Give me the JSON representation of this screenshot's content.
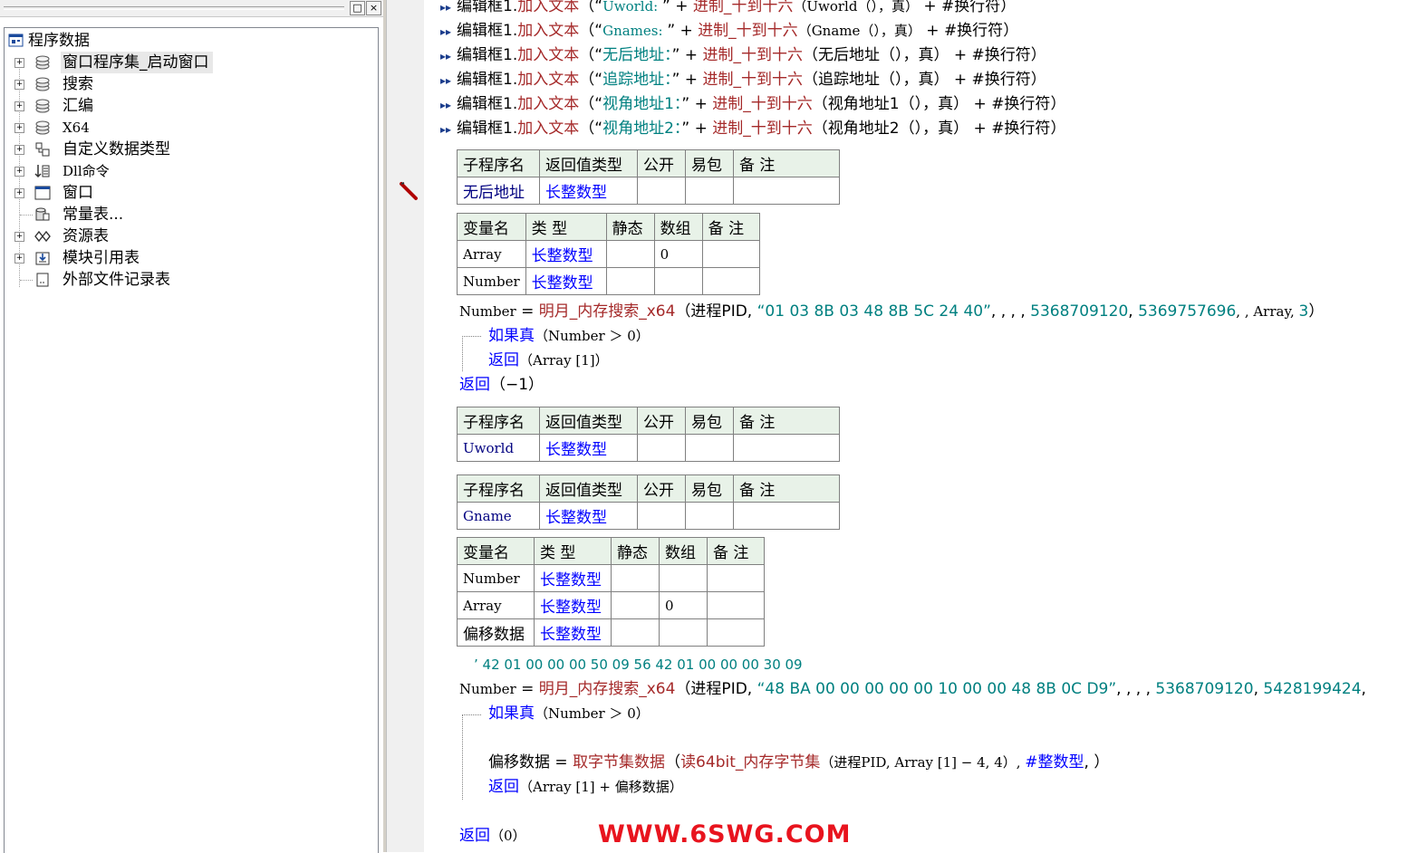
{
  "panel": {
    "restore_btn": "□",
    "close_btn": "×"
  },
  "tree": {
    "root": "程序数据",
    "items": [
      {
        "label": "窗口程序集_启动窗口",
        "icon": "assembly-icon"
      },
      {
        "label": "搜索",
        "icon": "assembly-icon"
      },
      {
        "label": "汇编",
        "icon": "assembly-icon"
      },
      {
        "label": "X64",
        "icon": "assembly-icon"
      },
      {
        "label": "自定义数据类型",
        "icon": "datatype-icon"
      },
      {
        "label": "Dll命令",
        "icon": "dll-icon"
      },
      {
        "label": "窗口",
        "icon": "window-icon"
      },
      {
        "label": "常量表...",
        "icon": "constant-icon"
      },
      {
        "label": "资源表",
        "icon": "resource-icon"
      },
      {
        "label": "模块引用表",
        "icon": "module-icon"
      },
      {
        "label": "外部文件记录表",
        "icon": "file-icon"
      }
    ]
  },
  "code": {
    "top_lines": [
      {
        "obj": "编辑框1.",
        "method": "加入文本",
        "open": "（“",
        "str": "Uworld: ",
        "close": "”",
        "plus1": " + ",
        "fn": "进制_十到十六",
        "args": "（Uworld（），真）",
        "plus2": " + ",
        "nl": "#换行符",
        "end": "）"
      },
      {
        "obj": "编辑框1.",
        "method": "加入文本",
        "open": "（“",
        "str": "Gnames: ",
        "close": "”",
        "plus1": " + ",
        "fn": "进制_十到十六",
        "args": "（Gname（），真）",
        "plus2": " + ",
        "nl": "#换行符",
        "end": "）"
      },
      {
        "obj": "编辑框1.",
        "method": "加入文本",
        "open": "（“",
        "str": "无后地址：",
        "close": "”",
        "plus1": " + ",
        "fn": "进制_十到十六",
        "args": "（无后地址（），真）",
        "plus2": " + ",
        "nl": "#换行符",
        "end": "）"
      },
      {
        "obj": "编辑框1.",
        "method": "加入文本",
        "open": "（“",
        "str": "追踪地址：",
        "close": "”",
        "plus1": " + ",
        "fn": "进制_十到十六",
        "args": "（追踪地址（），真）",
        "plus2": " + ",
        "nl": "#换行符",
        "end": "）"
      },
      {
        "obj": "编辑框1.",
        "method": "加入文本",
        "open": "（“",
        "str": "视角地址1：",
        "close": "”",
        "plus1": " + ",
        "fn": "进制_十到十六",
        "args": "（视角地址1（），真）",
        "plus2": " + ",
        "nl": "#换行符",
        "end": "）"
      },
      {
        "obj": "编辑框1.",
        "method": "加入文本",
        "open": "（“",
        "str": "视角地址2：",
        "close": "”",
        "plus1": " + ",
        "fn": "进制_十到十六",
        "args": "（视角地址2（），真）",
        "plus2": " + ",
        "nl": "#换行符",
        "end": "）"
      }
    ],
    "sub_header": [
      "子程序名",
      "返回值类型",
      "公开",
      "易包",
      "备 注"
    ],
    "var_header": [
      "变量名",
      "类 型",
      "静态",
      "数组",
      "备 注"
    ],
    "sub1": {
      "name": "无后地址",
      "type": "长整数型"
    },
    "sub1_vars": [
      {
        "name": "Array",
        "type": "长整数型",
        "array": "0"
      },
      {
        "name": "Number",
        "type": "长整数型",
        "array": ""
      }
    ],
    "l1": {
      "lhs": "Number",
      "eq": " = ",
      "fn": "明月_内存搜索_x64",
      "open": "（进程PID, ",
      "str": "“01 03 8B 03 48 8B 5C 24 40”",
      "rest": ", , , , ",
      "n1": "5368709120",
      "c1": ", ",
      "n2": "5369757696",
      "c2": ", , Array, ",
      "n3": "3",
      "end": "）"
    },
    "l2": {
      "kw": "如果真",
      "args": "（Number ＞ 0）"
    },
    "l3": {
      "kw": "返回",
      "args": "（Array [1]）"
    },
    "l4": {
      "kw": "返回",
      "args": "（−1）"
    },
    "sub2": {
      "name": "Uworld",
      "type": "长整数型"
    },
    "sub3": {
      "name": "Gname",
      "type": "长整数型"
    },
    "sub3_vars": [
      {
        "name": "Number",
        "type": "长整数型",
        "array": ""
      },
      {
        "name": "Array",
        "type": "长整数型",
        "array": "0"
      },
      {
        "name": "偏移数据",
        "type": "长整数型",
        "array": ""
      }
    ],
    "comment": "’ 42 01 00 00 00 50 09 56 42 01 00 00 00 30 09",
    "l5": {
      "lhs": "Number",
      "eq": " = ",
      "fn": "明月_内存搜索_x64",
      "open": "（进程PID, ",
      "str": "“48 BA 00 00 00 00 00 10 00 00 48 8B 0C D9”",
      "rest": ", , , , ",
      "n1": "5368709120",
      "c1": ", ",
      "n2": "5428199424",
      "c2": ","
    },
    "l6": {
      "kw": "如果真",
      "args": "（Number ＞ 0）"
    },
    "l7": {
      "lhs": "偏移数据",
      "eq": " = ",
      "fn": "取字节集数据",
      "open": "（",
      "fn2": "读64bit_内存字节集",
      "args": "（进程PID, Array [1] − 4, 4）, ",
      "const": "#整数型",
      "end": ", ）"
    },
    "l8": {
      "kw": "返回",
      "args": "（Array [1] + 偏移数据）"
    },
    "l9": {
      "kw": "返回",
      "args": "（0）"
    }
  },
  "gutter": {
    "minus": "−",
    "plus": "+"
  },
  "watermark": "WWW.6SWG.COM",
  "colors": {
    "keyword": "#0000ff",
    "method": "#a52a2a",
    "string": "#008080",
    "table_header": "#e8f2e8",
    "watermark": "#e8141e"
  }
}
